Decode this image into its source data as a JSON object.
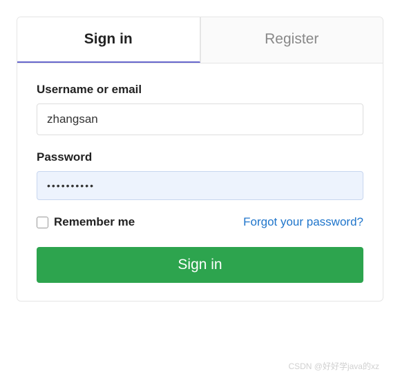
{
  "tabs": {
    "signin": "Sign in",
    "register": "Register"
  },
  "form": {
    "username_label": "Username or email",
    "username_value": "zhangsan",
    "password_label": "Password",
    "password_value": "••••••••••",
    "remember_label": "Remember me",
    "forgot_label": "Forgot your password?",
    "submit_label": "Sign in"
  },
  "watermark": "CSDN @好好学java的xz"
}
